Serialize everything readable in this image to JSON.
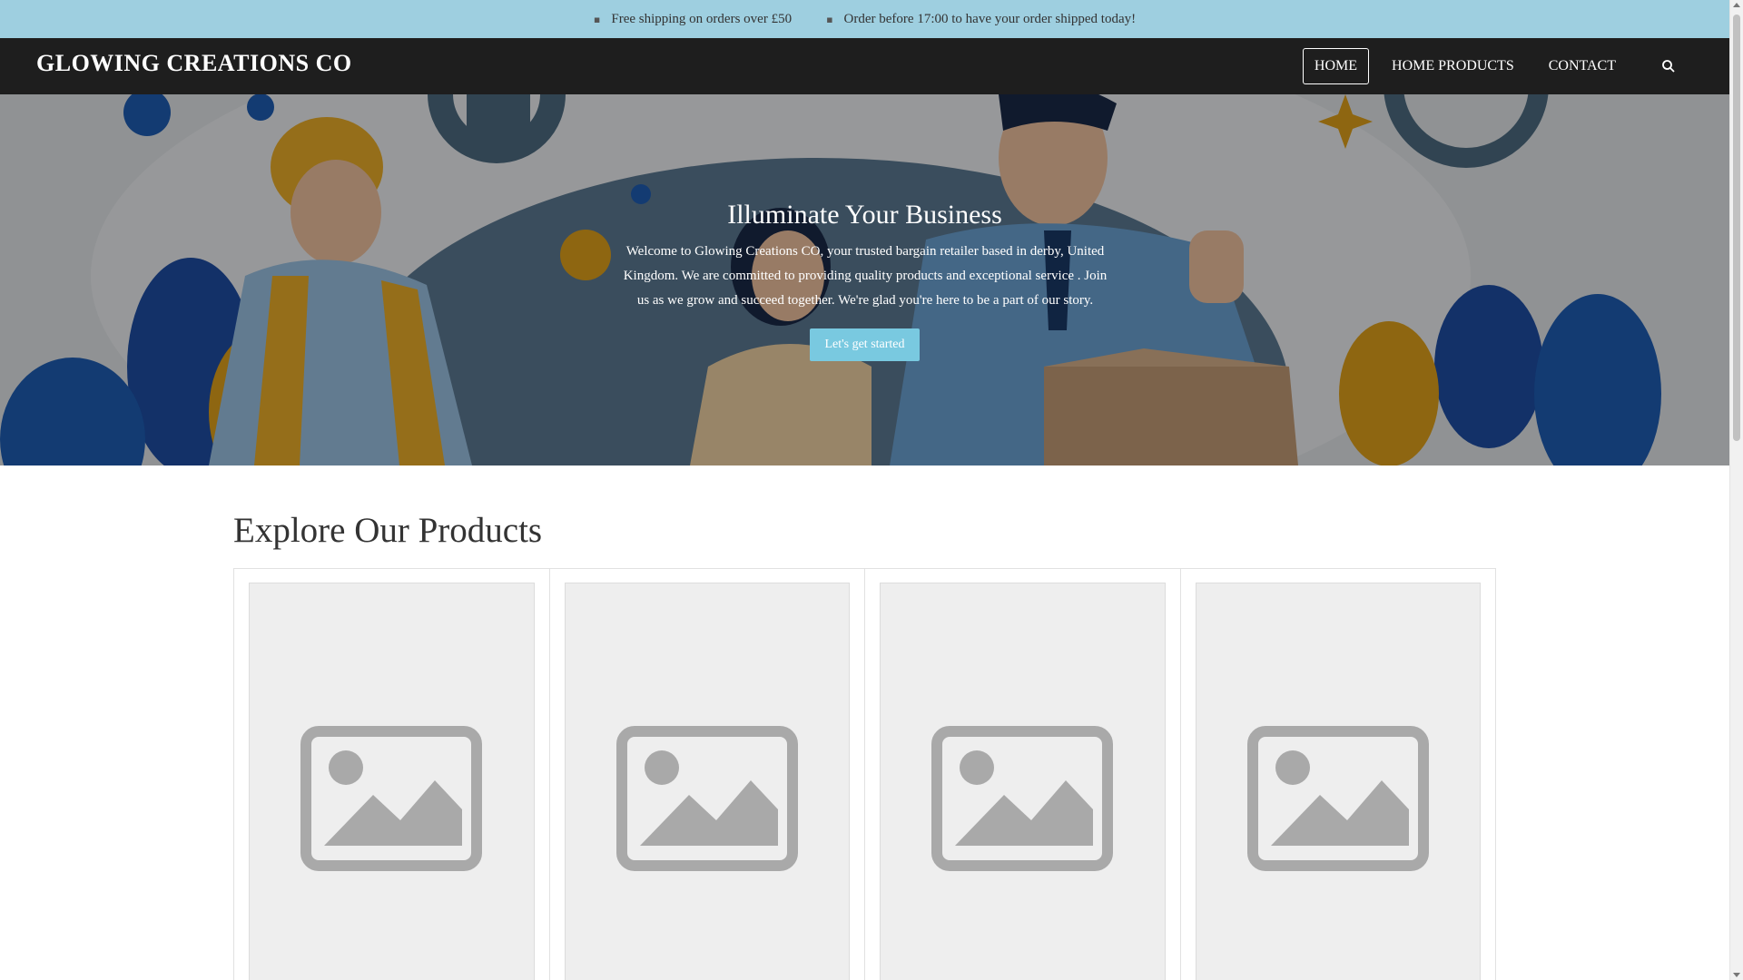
{
  "announcement": {
    "items": [
      {
        "icon": "truck-icon",
        "text": "Free shipping on orders over £50"
      },
      {
        "icon": "clock-icon",
        "text": "Order before 17:00 to have your order shipped today!"
      }
    ]
  },
  "header": {
    "brand": "GLOWING CREATIONS CO",
    "nav": [
      {
        "label": "HOME",
        "active": true
      },
      {
        "label": "HOME PRODUCTS",
        "active": false
      },
      {
        "label": "CONTACT",
        "active": false
      }
    ],
    "search_icon": "search-icon"
  },
  "hero": {
    "title": "Illuminate Your Business",
    "text": "Welcome to Glowing Creations CO, your trusted bargain retailer based in derby, United Kingdom. We are committed to providing quality products and exceptional service . Join us as we grow and succeed together. We're glad you're here to be a part of our story.",
    "button": "Let's get started"
  },
  "products": {
    "title": "Explore Our Products",
    "cards": [
      {
        "image_icon": "image-placeholder-icon"
      },
      {
        "image_icon": "image-placeholder-icon"
      },
      {
        "image_icon": "image-placeholder-icon"
      },
      {
        "image_icon": "image-placeholder-icon"
      }
    ]
  },
  "colors": {
    "announcement_bg": "#9ecfe0",
    "header_bg": "#1e1e1e",
    "button_bg": "#79c9e0"
  }
}
